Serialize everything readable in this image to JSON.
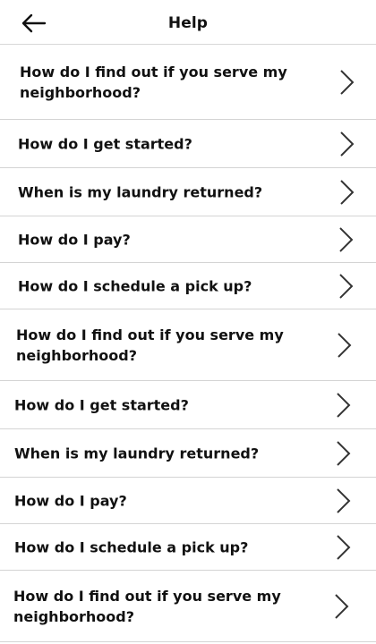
{
  "header": {
    "back_icon": "arrow-left-icon",
    "title": "Help"
  },
  "faq": {
    "items": [
      {
        "question": "How do I find out if you serve my neighborhood?"
      },
      {
        "question": "How do I get started?"
      },
      {
        "question": "When is my laundry returned?"
      },
      {
        "question": "How do I pay?"
      },
      {
        "question": "How do I schedule a pick up?"
      },
      {
        "question": "How do I find out if you serve my neighborhood?"
      },
      {
        "question": "How do I get started?"
      },
      {
        "question": "When is my laundry returned?"
      },
      {
        "question": "How do I pay?"
      },
      {
        "question": "How do I schedule a pick up?"
      },
      {
        "question": "How do I find out if you serve my neighborhood?"
      }
    ],
    "row_icon": "chevron-right-icon"
  }
}
